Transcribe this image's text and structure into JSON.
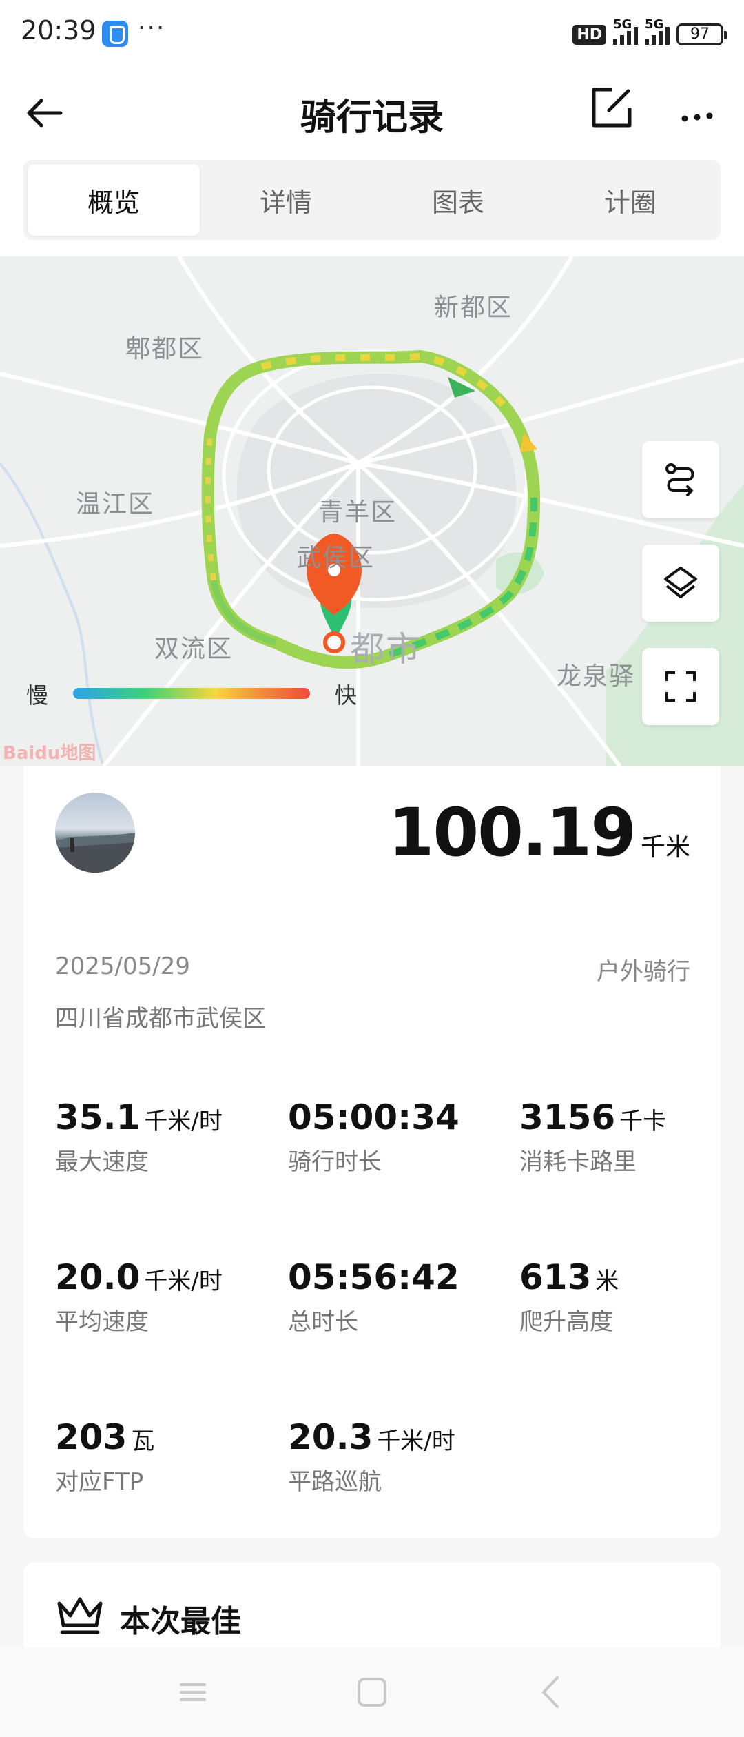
{
  "status": {
    "time": "20:39",
    "dots": "···",
    "hd": "HD",
    "net1": "5G",
    "net2": "5G",
    "battery": "97"
  },
  "header": {
    "title": "骑行记录"
  },
  "tabs": [
    {
      "label": "概览",
      "active": true
    },
    {
      "label": "详情",
      "active": false
    },
    {
      "label": "图表",
      "active": false
    },
    {
      "label": "计圈",
      "active": false
    }
  ],
  "map": {
    "labels": {
      "xindu": "新都区",
      "pidu": "郫都区",
      "wenjiang": "温江区",
      "qingyang": "青羊区",
      "wuhou": "武侯区",
      "shuangliu": "双流区",
      "chengdu": "都市",
      "longquan": "龙泉驿"
    },
    "legend": {
      "slow": "慢",
      "fast": "快"
    },
    "logo": "Baidu地图"
  },
  "summary": {
    "distance_value": "100.19",
    "distance_unit": "千米",
    "date": "2025/05/29",
    "ride_type": "户外骑行",
    "location": "四川省成都市武侯区"
  },
  "stats": [
    {
      "value": "35.1",
      "unit": "千米/时",
      "label": "最大速度"
    },
    {
      "value": "05:00:34",
      "unit": "",
      "label": "骑行时长"
    },
    {
      "value": "3156",
      "unit": "千卡",
      "label": "消耗卡路里"
    },
    {
      "value": "20.0",
      "unit": "千米/时",
      "label": "平均速度"
    },
    {
      "value": "05:56:42",
      "unit": "",
      "label": "总时长"
    },
    {
      "value": "613",
      "unit": "米",
      "label": "爬升高度"
    },
    {
      "value": "203",
      "unit": "瓦",
      "label": "对应FTP"
    },
    {
      "value": "20.3",
      "unit": "千米/时",
      "label": "平路巡航"
    }
  ],
  "best": {
    "title": "本次最佳"
  }
}
